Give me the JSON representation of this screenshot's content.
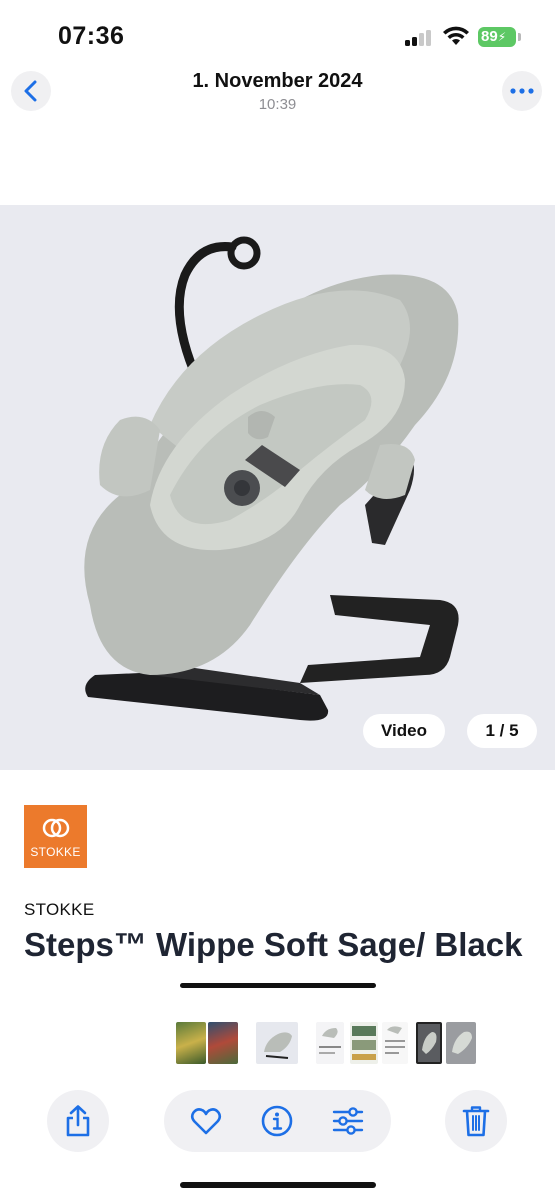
{
  "status_bar": {
    "time": "07:36",
    "battery": "89"
  },
  "header": {
    "title": "1. November 2024",
    "subtitle": "10:39",
    "back_icon": "chevron-left-icon",
    "more_icon": "ellipsis-icon"
  },
  "media": {
    "video_label": "Video",
    "page_indicator": "1 / 5"
  },
  "product": {
    "logo_text": "STOKKE",
    "brand": "STOKKE",
    "title": "Steps™ Wippe Soft Sage/ Black"
  },
  "toolbar": {
    "share_icon": "share-icon",
    "favorite_icon": "heart-icon",
    "info_icon": "info-icon",
    "adjust_icon": "sliders-icon",
    "delete_icon": "trash-icon"
  },
  "colors": {
    "accent": "#1d6fe6",
    "battery": "#5dc864",
    "brand": "#ec7a2c"
  }
}
